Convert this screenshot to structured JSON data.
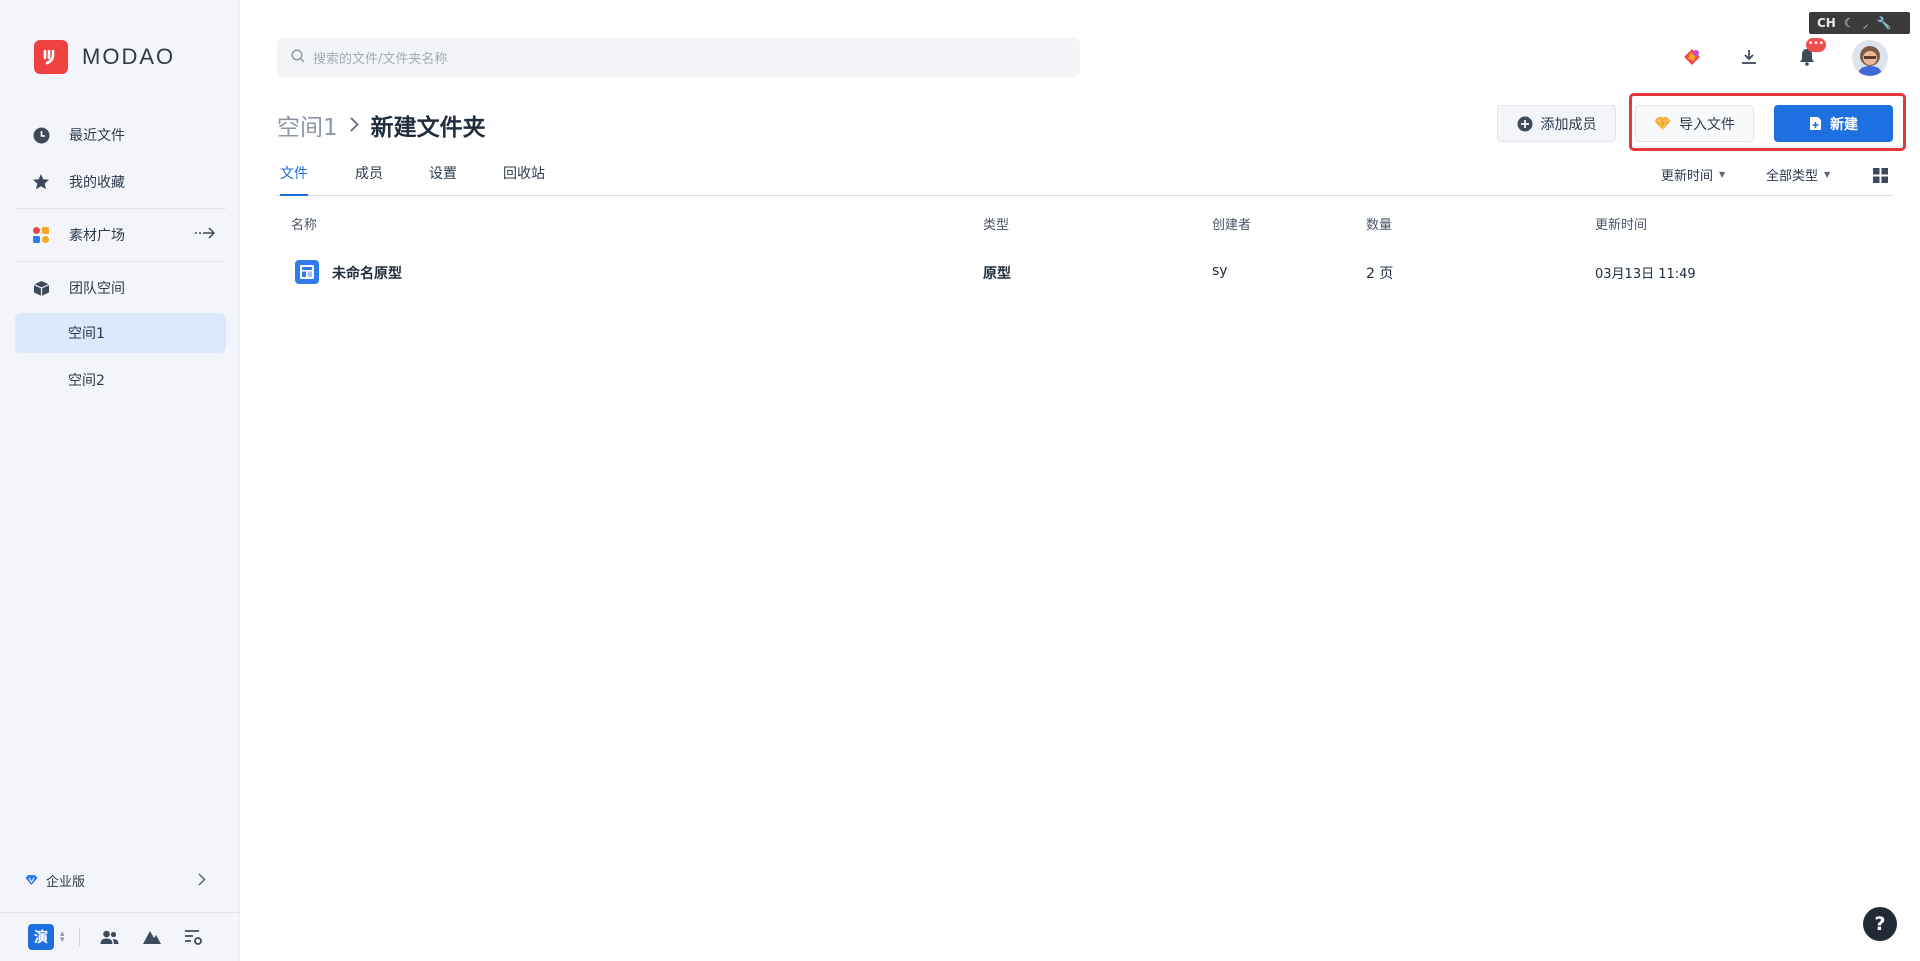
{
  "brand": {
    "name": "MODAO",
    "color": "#f04141"
  },
  "sidebar": {
    "items": [
      {
        "label": "最近文件",
        "icon": "clock-icon"
      },
      {
        "label": "我的收藏",
        "icon": "star-icon"
      },
      {
        "label": "素材广场",
        "icon": "apps-icon"
      },
      {
        "label": "团队空间",
        "icon": "cube-icon"
      }
    ],
    "spaces": [
      {
        "label": "空间1",
        "active": true
      },
      {
        "label": "空间2",
        "active": false
      }
    ],
    "enterprise_label": "企业版",
    "workspace_badge": "演"
  },
  "search": {
    "placeholder": "搜索的文件/文件夹名称"
  },
  "top_bar": {
    "ch_label": "CH",
    "notification_badge": "•••"
  },
  "breadcrumb": {
    "space": "空间1",
    "separator": ">",
    "current": "新建文件夹"
  },
  "actions": {
    "add_member": "添加成员",
    "import_file": "导入文件",
    "new": "新建"
  },
  "tabs": [
    {
      "label": "文件",
      "active": true
    },
    {
      "label": "成员",
      "active": false
    },
    {
      "label": "设置",
      "active": false
    },
    {
      "label": "回收站",
      "active": false
    }
  ],
  "filters": {
    "sort": "更新时间",
    "type": "全部类型"
  },
  "table": {
    "headers": [
      "名称",
      "类型",
      "创建者",
      "数量",
      "更新时间"
    ],
    "rows": [
      {
        "name": "未命名原型",
        "type": "原型",
        "creator": "sy",
        "count": "2 页",
        "updated": "03月13日 11:49"
      }
    ]
  },
  "help_label": "?",
  "colors": {
    "accent": "#1e6fe0",
    "highlight": "#e4363b",
    "sidebar_bg": "#f3f5fa"
  }
}
